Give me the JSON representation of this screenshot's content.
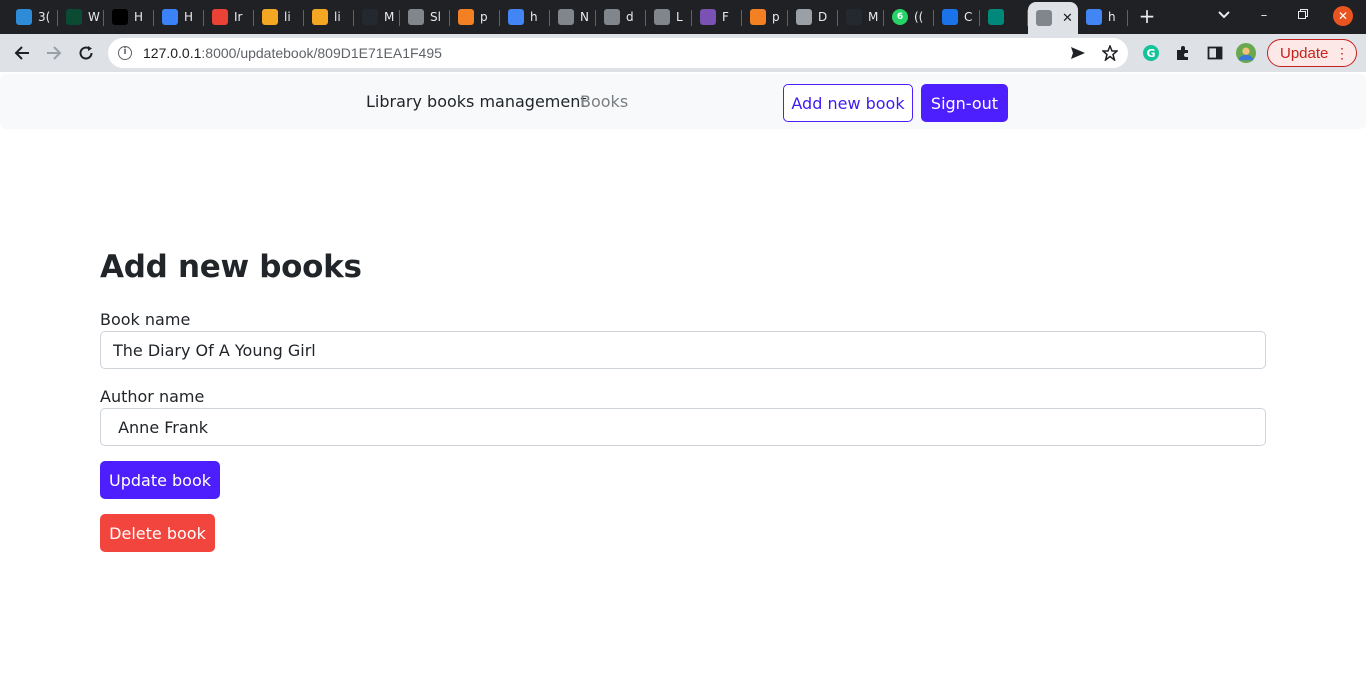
{
  "browser": {
    "tabs": [
      {
        "favicon": "mountain-icon",
        "title": "3(",
        "color": "#2d8bd8"
      },
      {
        "favicon": "django-icon",
        "title": "W",
        "color": "#0c4b33"
      },
      {
        "favicon": "dev-icon",
        "title": "H",
        "color": "#000000"
      },
      {
        "favicon": "refresh-logo-icon",
        "title": "H",
        "color": "#3b82f6"
      },
      {
        "favicon": "gmail-icon",
        "title": "Ir",
        "color": "#ea4335"
      },
      {
        "favicon": "infinity-icon",
        "title": "li",
        "color": "#f5a623"
      },
      {
        "favicon": "infinity-icon",
        "title": "li",
        "color": "#f5a623"
      },
      {
        "favicon": "github-icon",
        "title": "M",
        "color": "#24292f"
      },
      {
        "favicon": "globe-icon",
        "title": "Sl",
        "color": "#80868b"
      },
      {
        "favicon": "stackoverflow-icon",
        "title": "p",
        "color": "#f48024"
      },
      {
        "favicon": "google-icon",
        "title": "h",
        "color": "#4285f4"
      },
      {
        "favicon": "globe-icon",
        "title": "N",
        "color": "#80868b"
      },
      {
        "favicon": "globe-icon",
        "title": "d",
        "color": "#80868b"
      },
      {
        "favicon": "globe-icon",
        "title": "L",
        "color": "#80868b"
      },
      {
        "favicon": "bootstrap-icon",
        "title": "F",
        "color": "#7952b3"
      },
      {
        "favicon": "stackoverflow-icon",
        "title": "p",
        "color": "#f48024"
      },
      {
        "favicon": "image-icon",
        "title": "D",
        "color": "#9aa0a6"
      },
      {
        "favicon": "github-icon",
        "title": "M",
        "color": "#24292f"
      },
      {
        "favicon": "whatsapp-icon",
        "title": "((",
        "color": "#25d366",
        "badge": "6"
      },
      {
        "favicon": "code-icon",
        "title": "C",
        "color": "#1a73e8"
      },
      {
        "favicon": "meet-icon",
        "title": "",
        "color": "#00897b"
      },
      {
        "favicon": "globe-icon",
        "title": "",
        "color": "#80868b",
        "active": true
      },
      {
        "favicon": "google-icon",
        "title": "h",
        "color": "#4285f4"
      }
    ],
    "url_host": "127.0.0.1",
    "url_rest": ":8000/updatebook/809D1E71EA1F495",
    "update_label": "Update",
    "accent_update": "#c5221f"
  },
  "navbar": {
    "brand": "Library books management",
    "books_link": "Books",
    "add_new_book": "Add new book",
    "sign_out": "Sign-out"
  },
  "form": {
    "heading": "Add new books",
    "book_name_label": "Book name",
    "book_name_value": "The Diary Of A Young Girl",
    "author_name_label": "Author name",
    "author_name_value": " Anne Frank",
    "update_button": "Update book",
    "delete_button": "Delete book"
  },
  "colors": {
    "primary": "#4d1fff",
    "danger": "#f2453d",
    "navbar_bg": "#f8f9fa"
  }
}
